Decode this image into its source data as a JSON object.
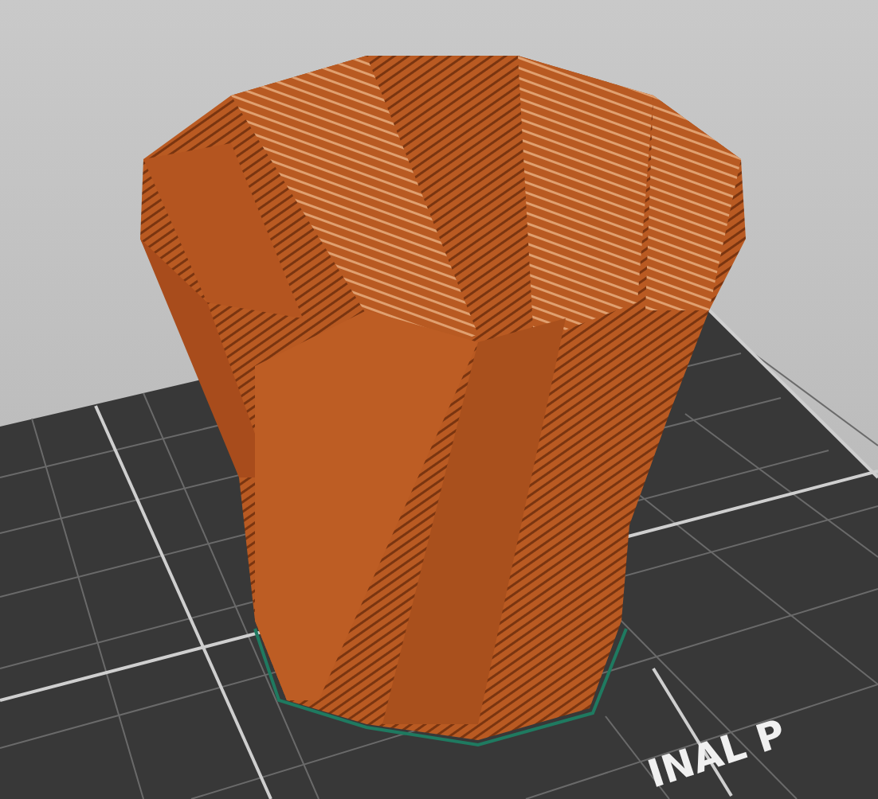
{
  "viewport": {
    "bed_label": "INAL P"
  }
}
